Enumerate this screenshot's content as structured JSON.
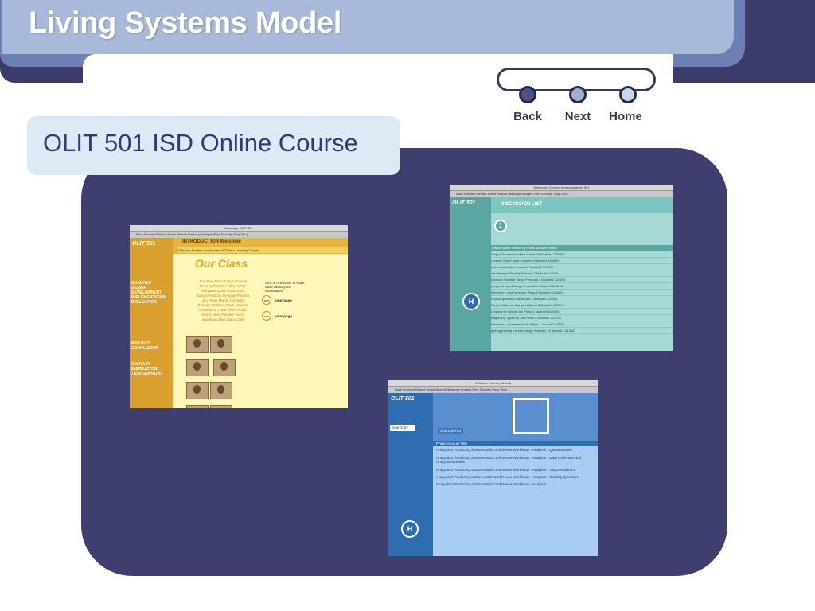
{
  "slide": {
    "title": "Living Systems Model",
    "subtitle": "OLIT 501 ISD Online Course"
  },
  "nav": {
    "back_label": "Back",
    "next_label": "Next",
    "home_label": "Home"
  },
  "shot1": {
    "window_title": "Netscape: OLIT 501",
    "toolbar": "Back  Forward  Reload  Home  Search  Netscape  Images  Print  Security  Shop  Stop",
    "header": "INTRODUCTION   Welcome",
    "tabs": "Video  Ice Breaker  Course Intro  ISD Intro  Learning  Contact",
    "menu": [
      "ANALYSIS",
      "DESIGN",
      "DEVELOPMENT",
      "IMPLEMENTATION",
      "EVALUATION",
      "PROJECT",
      "CONCLUSION",
      "CONTACT INSTRUCTOR",
      "TECH SUPPORT"
    ],
    "our_class": "Our Class",
    "click_note": "click on the icons to learn more about your classmates",
    "your_page": "your page"
  },
  "shot2": {
    "window_title": "Netscape: Communication systems 501",
    "heading": "DISCUSSION LIST",
    "table_head": [
      "Thread Name",
      "Posted By",
      "Posts",
      "Module",
      "Posted"
    ],
    "rows": [
      [
        "Project Discussion",
        "Mark Howard",
        "5",
        "Module4",
        "3/25/00"
      ],
      [
        "Learner Guide",
        "Mark Howard",
        "4",
        "Module4",
        "3/24/00"
      ],
      [
        "Quiz Ideas",
        "Mark Howard",
        "2",
        "Module1",
        "3/15/00"
      ],
      [
        "Job Analysis",
        "Beverly Fletcher",
        "2",
        "Module4",
        "3/6/00"
      ],
      [
        "Decision Related",
        "Tanya Pendoza",
        "3",
        "Module4",
        "3/25/00"
      ],
      [
        "progress report",
        "Margit Horowitz",
        "1",
        "Module5",
        "2/21/00"
      ],
      [
        "Welcome - click here",
        "Jan Pless",
        "5",
        "Module1",
        "2/24/00"
      ],
      [
        "A quick question",
        "Elaine Dils",
        "2",
        "Module5",
        "2/20/00"
      ],
      [
        "Target Audience",
        "Margaret Quinn",
        "5",
        "Module5",
        "2/24/00"
      ],
      [
        "Grading for Needs",
        "Jan Pless",
        "1",
        "Module5",
        "3/20/00"
      ],
      [
        "Beginning Types for",
        "Jan Pless",
        "3",
        "Module2",
        "2/21/00"
      ],
      [
        "Welcome - please read",
        "Jan Pless",
        "1",
        "Module2",
        "2/3/00"
      ],
      [
        "getting used to the site",
        "Margit Horowitz",
        "10",
        "Module1",
        "2/19/00"
      ]
    ]
  },
  "shot3": {
    "window_title": "Netscape: Library Search",
    "search_by": "Search by",
    "searched_for": "Searched for",
    "head": [
      "Phase",
      "Module",
      "Title"
    ],
    "rows": [
      "Analysis 3 Producing a Successful Conference Workshop - Analysis - Questionnaire",
      "Analysis 3 Producing a Successful Conference Workshop - Analysis - Data Collection and Analysis Methods",
      "Analysis 3 Producing a Successful Conference Workshop - Analysis - Target Audience",
      "Analysis 3 Producing a Successful Conference Workshop - Analysis - Guiding Questions",
      "Analysis 3 Producing a Successful Conference Workshop - Analysis"
    ]
  }
}
